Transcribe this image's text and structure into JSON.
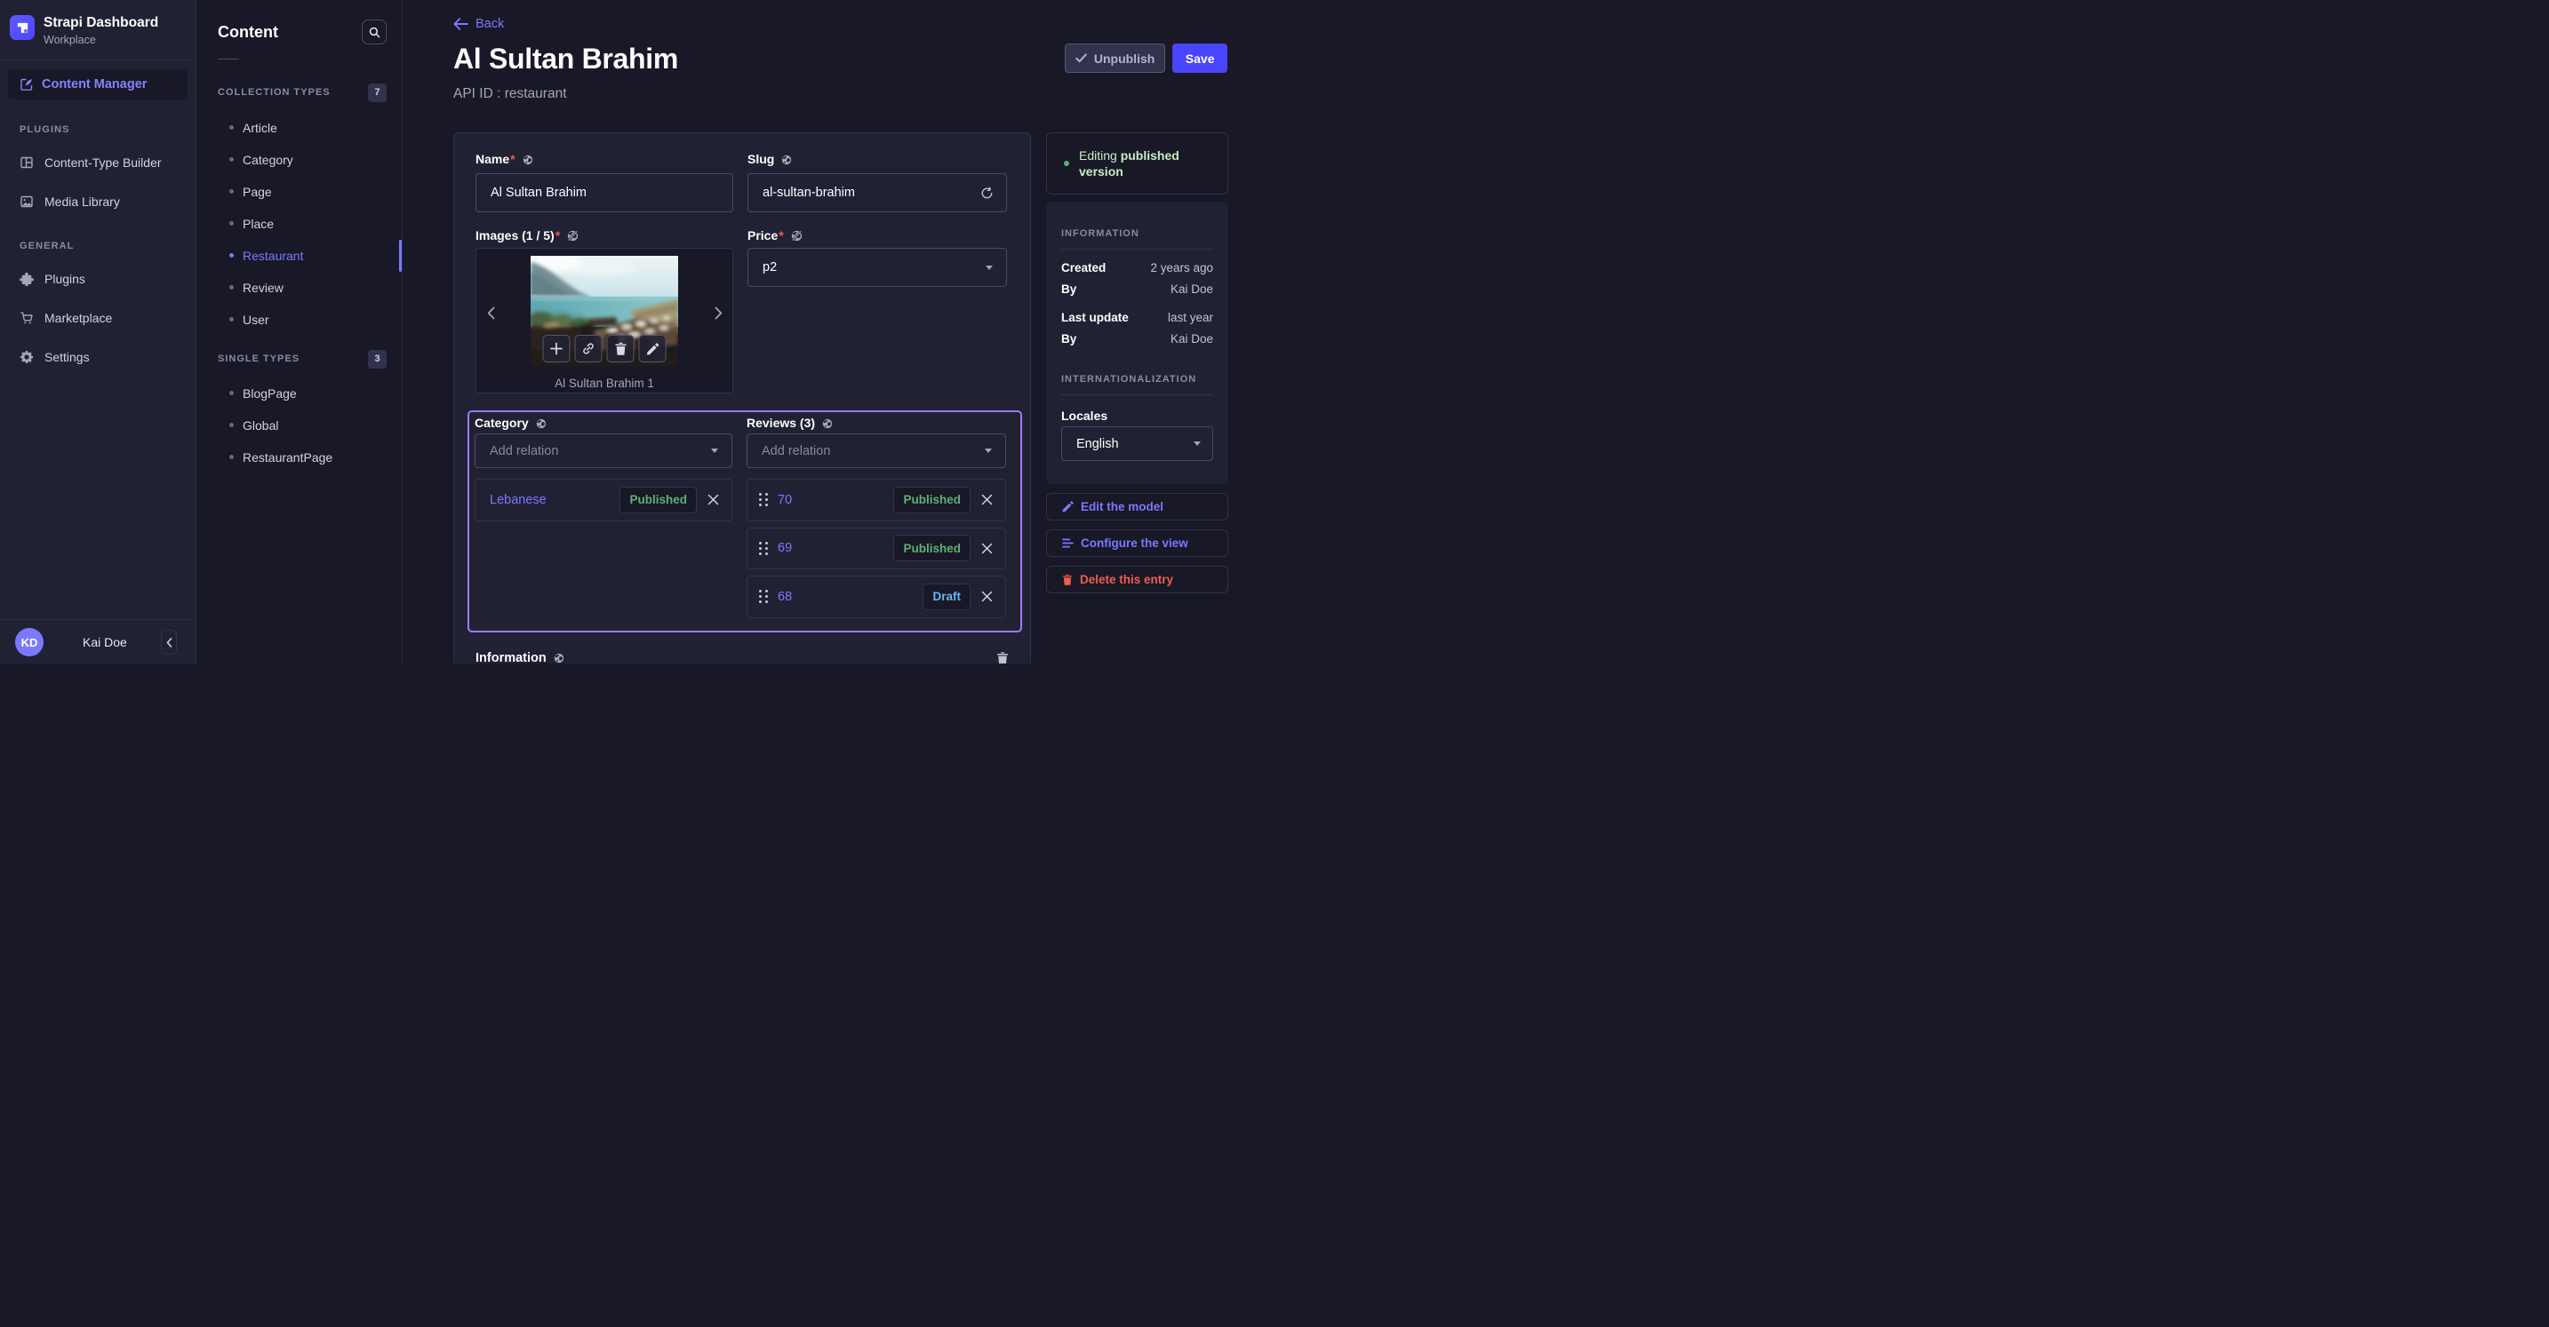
{
  "colors": {
    "background": "#181826",
    "surface": "#212134",
    "border": "#32324d",
    "input_border": "#4a4a6a",
    "accent_purple": "#7b79ff",
    "primary_indigo": "#4945ff",
    "highlight_outline": "#9b7bff",
    "success_green": "#5cb176",
    "success_pale": "#c6f0c2",
    "draft_blue": "#66b7f1",
    "danger_red": "#ee5e52",
    "text_dim": "#a5a5ba"
  },
  "icons": {
    "logo": "strapi-logo",
    "collapse_glyph": "‹",
    "carousel_prev_glyph": "‹",
    "carousel_next_glyph": "›",
    "list": [
      "content-manager-icon",
      "content-type-builder-icon",
      "media-library-icon",
      "plugins-icon",
      "marketplace-icon",
      "settings-icon",
      "search-icon",
      "back-arrow-icon",
      "check-icon",
      "globe-icon",
      "globe-strikethrough-icon",
      "refresh-icon",
      "plus-icon",
      "link-icon",
      "trash-icon",
      "pencil-icon",
      "caret-down-icon",
      "close-icon",
      "drag-handle-icon",
      "configure-view-icon"
    ]
  },
  "sidebar": {
    "brand_title": "Strapi Dashboard",
    "brand_subtitle": "Workplace",
    "active_item": "Content Manager",
    "sections": [
      {
        "title": "PLUGINS",
        "items": [
          "Content-Type Builder",
          "Media Library"
        ]
      },
      {
        "title": "GENERAL",
        "items": [
          "Plugins",
          "Marketplace",
          "Settings"
        ]
      }
    ],
    "footer": {
      "avatar_initials": "KD",
      "user_name": "Kai Doe"
    }
  },
  "subnav": {
    "title": "Content",
    "groups": [
      {
        "title": "COLLECTION TYPES",
        "badge": "7",
        "items": [
          "Article",
          "Category",
          "Page",
          "Place",
          "Restaurant",
          "Review",
          "User"
        ],
        "active_item": "Restaurant"
      },
      {
        "title": "SINGLE TYPES",
        "badge": "3",
        "items": [
          "BlogPage",
          "Global",
          "RestaurantPage"
        ]
      }
    ]
  },
  "header": {
    "back_label": "Back",
    "title": "Al Sultan Brahim",
    "api_id": "API ID : restaurant",
    "unpublish_label": "Unpublish",
    "save_label": "Save"
  },
  "form": {
    "required_mark": "*",
    "name": {
      "label": "Name",
      "value": "Al Sultan Brahim"
    },
    "slug": {
      "label": "Slug",
      "value": "al-sultan-brahim"
    },
    "images": {
      "label": "Images (1 / 5)",
      "caption": "Al Sultan Brahim 1"
    },
    "price": {
      "label": "Price",
      "value": "p2"
    },
    "category": {
      "label": "Category",
      "placeholder": "Add relation",
      "relations": [
        {
          "name": "Lebanese",
          "status": "Published"
        }
      ]
    },
    "reviews": {
      "label": "Reviews (3)",
      "placeholder": "Add relation",
      "relations": [
        {
          "name": "70",
          "status": "Published"
        },
        {
          "name": "69",
          "status": "Published"
        },
        {
          "name": "68",
          "status": "Draft"
        }
      ]
    },
    "information_label": "Information"
  },
  "right_panel": {
    "editing_status_prefix": "Editing ",
    "editing_status_bold": "published version",
    "information_title": "INFORMATION",
    "meta": [
      {
        "label": "Created",
        "value": "2 years ago"
      },
      {
        "label": "By",
        "value": "Kai Doe"
      },
      {
        "label": "Last update",
        "value": "last year"
      },
      {
        "label": "By",
        "value": "Kai Doe"
      }
    ],
    "i18n_title": "INTERNATIONALIZATION",
    "locales_label": "Locales",
    "locale_value": "English",
    "actions": [
      {
        "label": "Edit the model"
      },
      {
        "label": "Configure the view"
      },
      {
        "label": "Delete this entry"
      }
    ]
  }
}
